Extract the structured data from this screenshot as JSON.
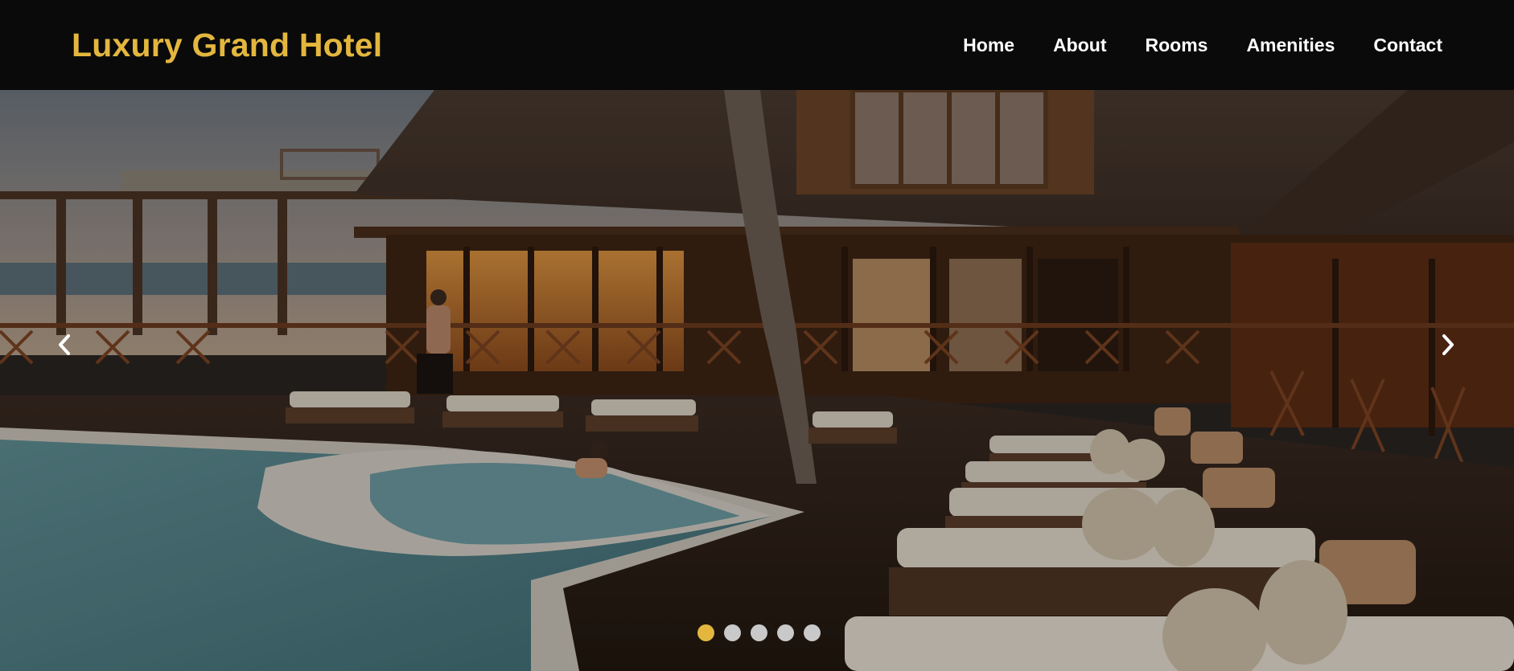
{
  "header": {
    "brand": "Luxury Grand Hotel",
    "nav": [
      "Home",
      "About",
      "Rooms",
      "Amenities",
      "Contact"
    ]
  },
  "carousel": {
    "prev_icon": "chevron-left-icon",
    "next_icon": "chevron-right-icon",
    "slide_count": 5,
    "active_index": 0
  },
  "colors": {
    "brand_gold": "#e3b63e",
    "header_bg": "#0a0a0a",
    "dot_inactive": "#c9c9c9"
  }
}
